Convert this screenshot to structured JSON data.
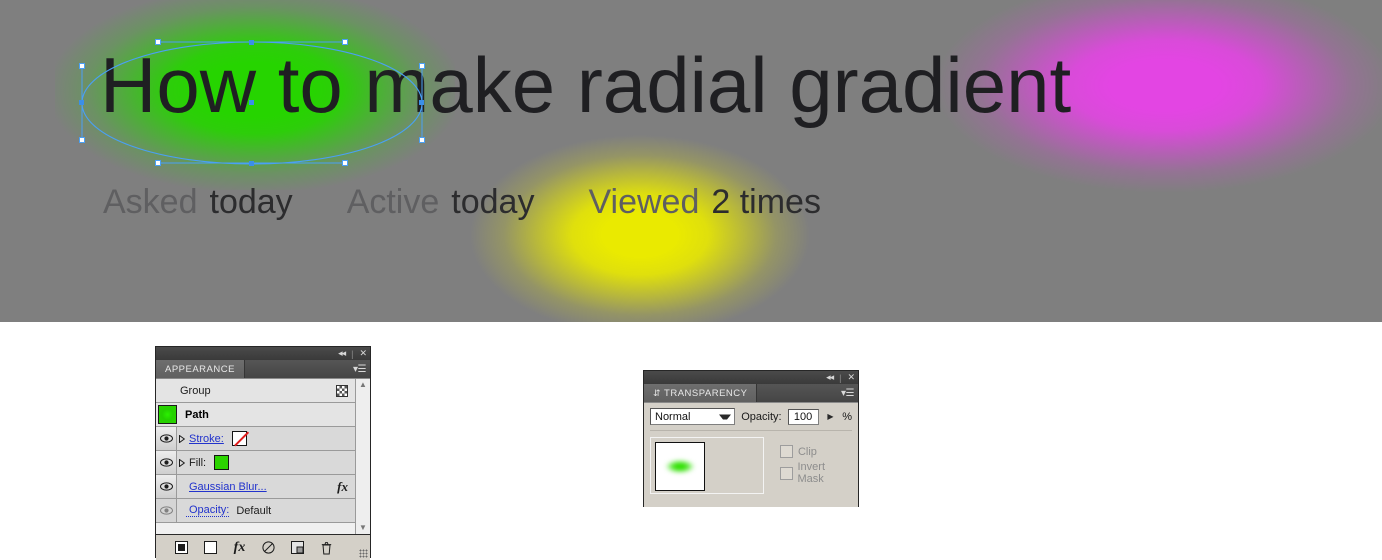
{
  "hero": {
    "title_parts": [
      {
        "text": "How to",
        "glow": "green"
      },
      {
        "text": " make radial ",
        "glow": "none"
      },
      {
        "text": "gradient",
        "glow": "magenta"
      }
    ],
    "title_full": "How to make radial gradient",
    "stats": {
      "asked_label": "Asked",
      "asked_value": "today",
      "active_label": "Active",
      "active_value": "today",
      "viewed_label": "Viewed",
      "viewed_value": "2 times"
    },
    "colors": {
      "background": "#7f7f7f",
      "green_glow": "#26d400",
      "magenta_glow": "#e345e3",
      "yellow_glow": "#eaea00",
      "selection_path": "#4aa0f5",
      "text": "#1f1f22"
    }
  },
  "appearance_panel": {
    "tab_label": "APPEARANCE",
    "collapse_icon": "collapse-double-arrow-icon",
    "close_icon": "close-icon",
    "menu_icon": "panel-menu-icon",
    "rows": [
      {
        "name": "group",
        "label": "Group",
        "has_eye": false,
        "indent": true,
        "right_icon": "checkerboard-icon"
      },
      {
        "name": "path",
        "label": "Path",
        "has_eye": false,
        "bold": true,
        "thumbnail": "green-blur-thumbnail"
      },
      {
        "name": "stroke",
        "label": "Stroke:",
        "has_eye": true,
        "triangle": true,
        "link": true,
        "swatch": "none"
      },
      {
        "name": "fill",
        "label": "Fill:",
        "has_eye": true,
        "triangle": true,
        "link": true,
        "swatch": "green"
      },
      {
        "name": "gaussian-blur",
        "label": "Gaussian Blur...",
        "has_eye": true,
        "link": true,
        "right_icon": "fx-icon"
      },
      {
        "name": "opacity",
        "label": "Opacity:",
        "value": "Default",
        "has_eye": true,
        "dotted": true
      }
    ],
    "scrollbar": {
      "up": "▲",
      "down": "▼"
    },
    "footer_buttons": [
      {
        "name": "add-new-stroke-button",
        "icon": "filled-square-icon",
        "glyph": "■"
      },
      {
        "name": "add-new-fill-button",
        "icon": "empty-square-icon",
        "glyph": "□"
      },
      {
        "name": "add-new-effect-button",
        "icon": "fx-icon",
        "glyph": "fx"
      },
      {
        "name": "clear-appearance-button",
        "icon": "no-symbol-icon",
        "glyph": "⊘"
      },
      {
        "name": "duplicate-item-button",
        "icon": "duplicate-icon",
        "glyph": "⧉"
      },
      {
        "name": "delete-item-button",
        "icon": "trash-icon",
        "glyph": "🗑"
      }
    ]
  },
  "transparency_panel": {
    "tab_label": "TRANSPARENCY",
    "tab_grip_icon": "panel-grip-icon",
    "collapse_icon": "collapse-double-arrow-icon",
    "close_icon": "close-icon",
    "menu_icon": "panel-menu-icon",
    "blend_mode": "Normal",
    "blend_mode_options": [
      "Normal"
    ],
    "opacity_label": "Opacity:",
    "opacity_value": "100",
    "percent_sign": "%",
    "stepper_icon": "stepper-arrow-icon",
    "thumbnail_name": "object-thumbnail",
    "checkboxes": [
      {
        "name": "clip-checkbox",
        "label": "Clip",
        "checked": false,
        "disabled": true
      },
      {
        "name": "invert-mask-checkbox",
        "label": "Invert Mask",
        "checked": false,
        "disabled": true
      }
    ]
  }
}
